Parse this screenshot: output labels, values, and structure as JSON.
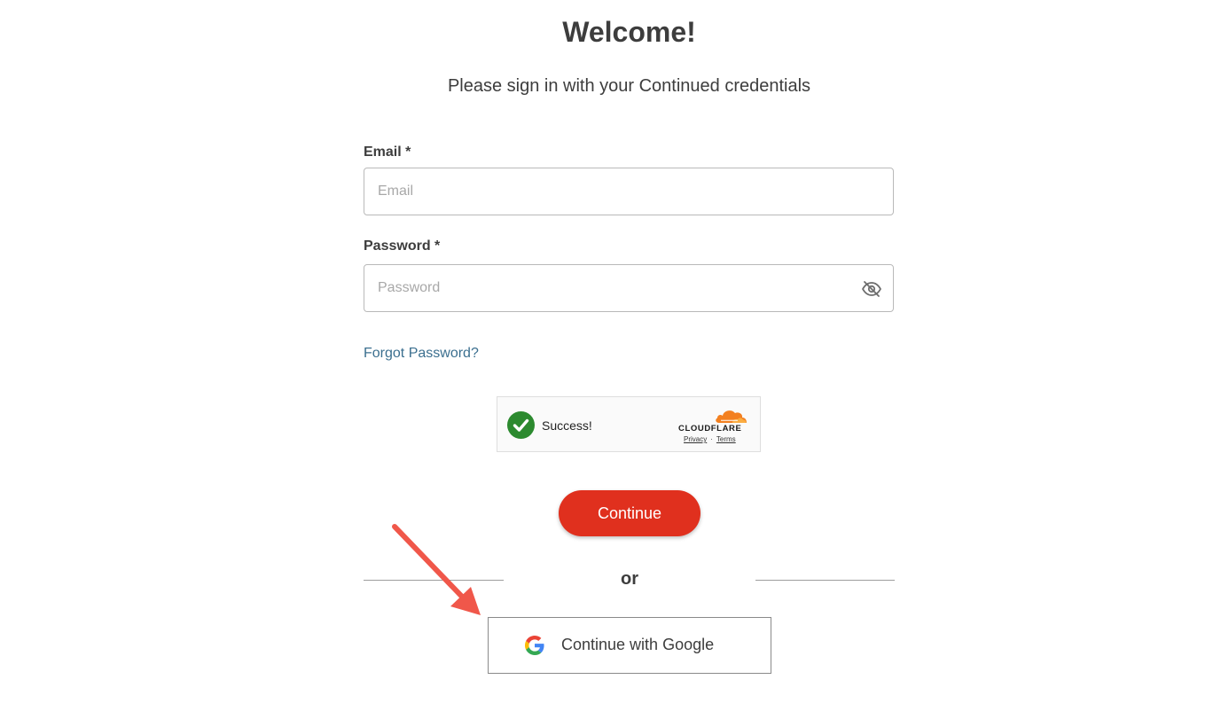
{
  "header": {
    "title": "Welcome!",
    "subtitle": "Please sign in with your Continued credentials"
  },
  "form": {
    "email": {
      "label": "Email *",
      "placeholder": "Email",
      "value": ""
    },
    "password": {
      "label": "Password *",
      "placeholder": "Password",
      "value": "",
      "toggle_icon": "eye-off-icon"
    },
    "forgot_password": "Forgot Password?"
  },
  "captcha": {
    "status": "Success!",
    "brand": "CLOUDFLARE",
    "privacy": "Privacy",
    "separator": "·",
    "terms": "Terms",
    "check_color": "#2c8a2f",
    "brand_color": "#f38020"
  },
  "actions": {
    "continue_label": "Continue",
    "divider_text": "or",
    "google_label": "Continue with Google",
    "continue_color": "#e0301e"
  },
  "annotation": {
    "arrow_color": "#f0574a"
  }
}
